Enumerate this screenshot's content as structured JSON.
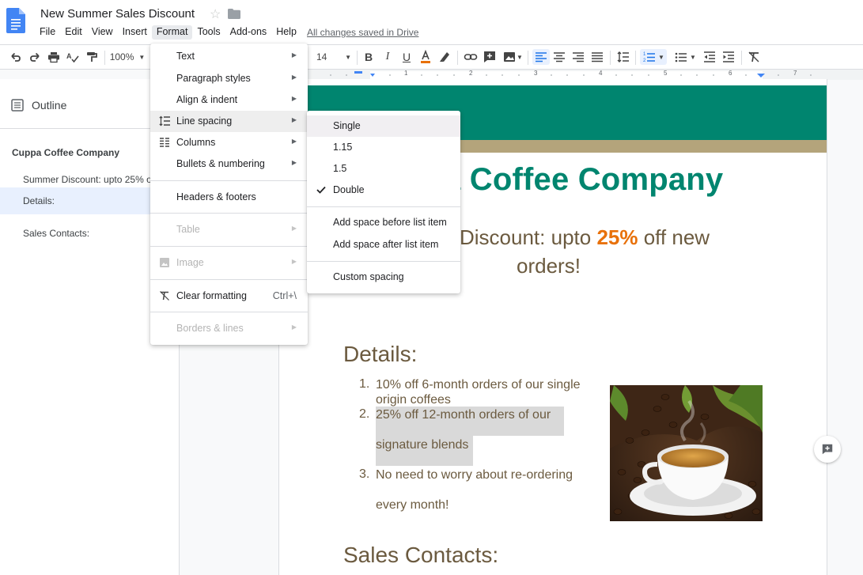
{
  "app": {
    "title": "New Summer Sales Discount",
    "saved_status": "All changes saved in Drive"
  },
  "menubar": [
    "File",
    "Edit",
    "View",
    "Insert",
    "Format",
    "Tools",
    "Add-ons",
    "Help"
  ],
  "toolbar": {
    "zoom": "100%",
    "font_size": "14"
  },
  "ruler": {
    "ticks": [
      "1",
      "2",
      "3",
      "4",
      "5",
      "6",
      "7"
    ]
  },
  "outline": {
    "title": "Outline",
    "items": [
      {
        "label": "Cuppa Coffee Company",
        "level": 1
      },
      {
        "label": "Summer Discount: upto 25% of",
        "level": 2
      },
      {
        "label": "Details:",
        "level": 2,
        "selected": true
      },
      {
        "label": "Sales Contacts:",
        "level": 2
      }
    ]
  },
  "format_menu": {
    "items": [
      {
        "label": "Text",
        "submenu": true
      },
      {
        "label": "Paragraph styles",
        "submenu": true
      },
      {
        "label": "Align & indent",
        "submenu": true
      },
      {
        "label": "Line spacing",
        "submenu": true,
        "icon": "line-spacing-icon",
        "highlighted": true
      },
      {
        "label": "Columns",
        "submenu": true,
        "icon": "columns-icon"
      },
      {
        "label": "Bullets & numbering",
        "submenu": true
      },
      {
        "label": "Headers & footers"
      },
      {
        "label": "Table",
        "submenu": true,
        "disabled": true
      },
      {
        "label": "Image",
        "submenu": true,
        "disabled": true,
        "icon": "image-icon"
      },
      {
        "label": "Clear formatting",
        "shortcut": "Ctrl+\\",
        "icon": "clear-formatting-icon"
      },
      {
        "label": "Borders & lines",
        "submenu": true,
        "disabled": true
      }
    ]
  },
  "spacing_menu": {
    "items": [
      {
        "label": "Single",
        "highlighted": true
      },
      {
        "label": "1.15"
      },
      {
        "label": "1.5"
      },
      {
        "label": "Double",
        "checked": true
      },
      {
        "label": "Add space before list item"
      },
      {
        "label": "Add space after list item"
      },
      {
        "label": "Custom spacing"
      }
    ]
  },
  "document": {
    "title_visible": "a Coffee Company",
    "subtitle_pre": "Discount: upto ",
    "subtitle_bold": "25%",
    "subtitle_post": " off new",
    "subtitle_line2": "orders!",
    "details_heading": "Details:",
    "list": [
      {
        "num": "1.",
        "line1": "10% off 6-month orders of our single",
        "line2": "origin coffees"
      },
      {
        "num": "2.",
        "line1": "25% off 12-month orders of our",
        "line2": "signature blends"
      },
      {
        "num": "3.",
        "line1": "No need to worry about re-ordering",
        "line2": "every month!"
      }
    ],
    "sales_heading": "Sales Contacts:"
  },
  "colors": {
    "brand_green": "#00856f",
    "tan_band": "#b4a47b",
    "heading_brown": "#6b5a3f",
    "accent_orange": "#e8710a"
  }
}
